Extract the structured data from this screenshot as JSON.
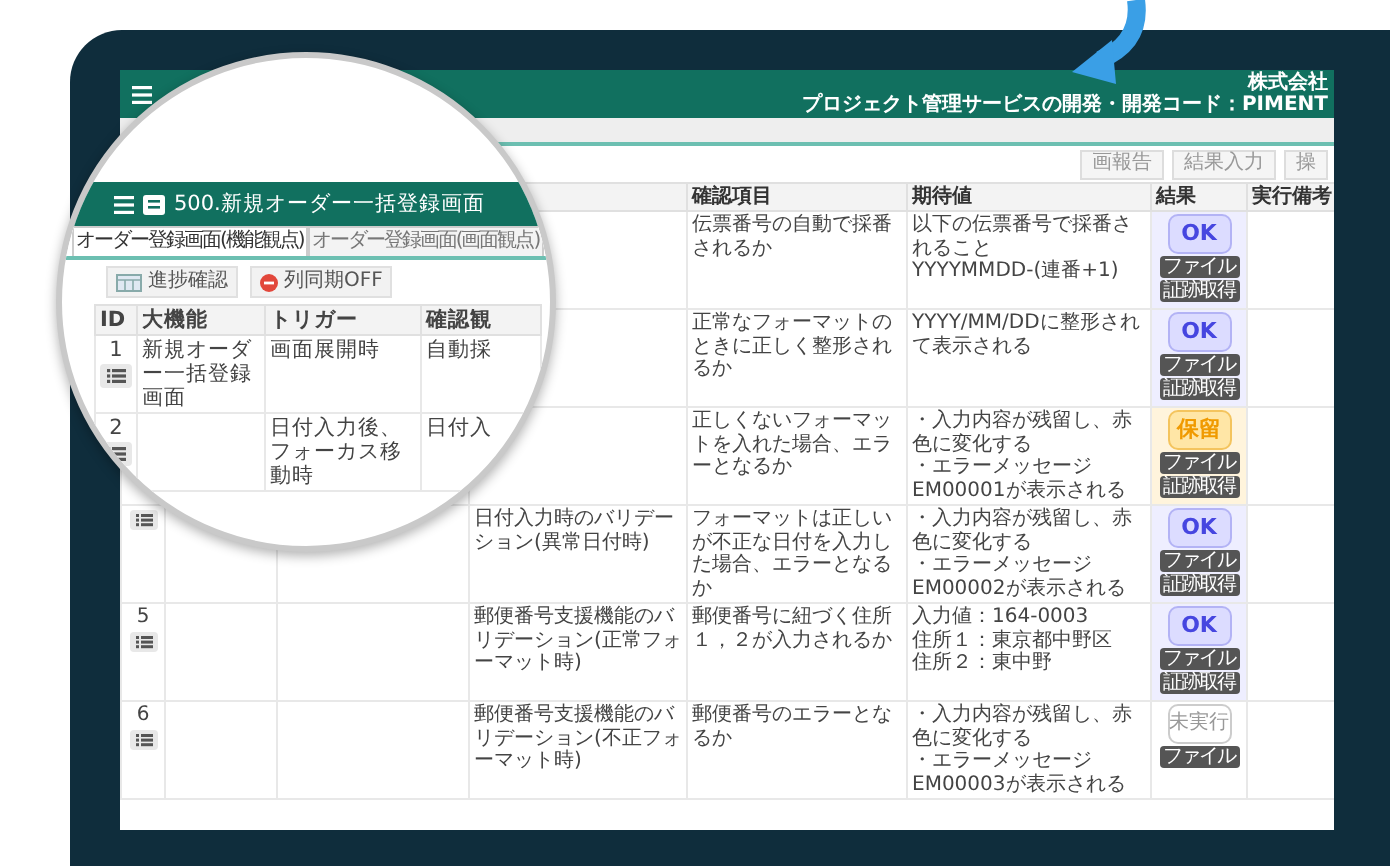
{
  "header": {
    "company": "株式会社",
    "project_info": "プロジェクト管理サービスの開発・開発コード：PIMENT"
  },
  "toolbar": {
    "buttons": [
      "画報告",
      "結果入力",
      "操"
    ]
  },
  "table": {
    "columns": [
      "確認項目",
      "期待値",
      "結果",
      "実行備考"
    ],
    "rows": [
      {
        "item": "伝票番号の自動で採番されるか",
        "expected": [
          "以下の伝票番号で採番されること",
          "YYYYMMDD-(連番+1)"
        ],
        "result": {
          "kind": "ok",
          "label": "OK"
        },
        "buttons": [
          "ファイル",
          "証跡取得"
        ]
      },
      {
        "item": "正常なフォーマットのときに正しく整形されるか",
        "expected": [
          "YYYY/MM/DDに整形されて表示される"
        ],
        "result": {
          "kind": "ok",
          "label": "OK"
        },
        "buttons": [
          "ファイル",
          "証跡取得"
        ]
      },
      {
        "item": "正しくないフォーマットを入れた場合、エラーとなるか",
        "expected": [
          "・入力内容が残留し、赤色に変化する",
          "・エラーメッセージEM00001が表示される"
        ],
        "result": {
          "kind": "hold",
          "label": "保留"
        },
        "buttons": [
          "ファイル",
          "証跡取得"
        ]
      },
      {
        "list_button": true,
        "viewpoint": "日付入力時のバリデーション(異常日付時)",
        "item": "フォーマットは正しいが不正な日付を入力した場合、エラーとなるか",
        "expected": [
          "・入力内容が残留し、赤色に変化する",
          "・エラーメッセージEM00002が表示される"
        ],
        "result": {
          "kind": "ok",
          "label": "OK"
        },
        "buttons": [
          "ファイル",
          "証跡取得"
        ]
      },
      {
        "id": "5",
        "list_button": true,
        "viewpoint": "郵便番号支援機能のバリデーション(正常フォーマット時)",
        "item": "郵便番号に紐づく住所１，２が入力されるか",
        "expected": [
          "入力値：164-0003",
          "住所１：東京都中野区",
          "住所２：東中野"
        ],
        "result": {
          "kind": "ok",
          "label": "OK"
        },
        "buttons": [
          "ファイル",
          "証跡取得"
        ]
      },
      {
        "id": "6",
        "list_button": true,
        "viewpoint": "郵便番号支援機能のバリデーション(不正フォーマット時)",
        "item": "郵便番号のエラーとなるか",
        "expected": [
          "・入力内容が残留し、赤色に変化する",
          "・エラーメッセージEM00003が表示される"
        ],
        "result": {
          "kind": "not_run",
          "label": "未実行"
        },
        "buttons": [
          "ファイル"
        ]
      }
    ]
  },
  "magnifier": {
    "title": "500.新規オーダー一括登録画面",
    "tabs": [
      {
        "label": "オーダー登録画面(機能観点)",
        "selected": true
      },
      {
        "label": "オーダー登録画面(画面観点)",
        "selected": false
      }
    ],
    "buttons": [
      {
        "kind": "progress",
        "label": "進捗確認"
      },
      {
        "kind": "sync",
        "label": "列同期OFF"
      }
    ],
    "columns": [
      "ID",
      "大機能",
      "トリガー",
      "確認観"
    ],
    "rows": [
      {
        "id": "1",
        "list_button": true,
        "feature": "新規オーダー一括登録画面",
        "trigger": "画面展開時",
        "viewpoint": "自動採"
      },
      {
        "id": "2",
        "list_button": true,
        "trigger": "日付入力後、フォーカス移動時",
        "viewpoint": "日付入"
      }
    ]
  }
}
